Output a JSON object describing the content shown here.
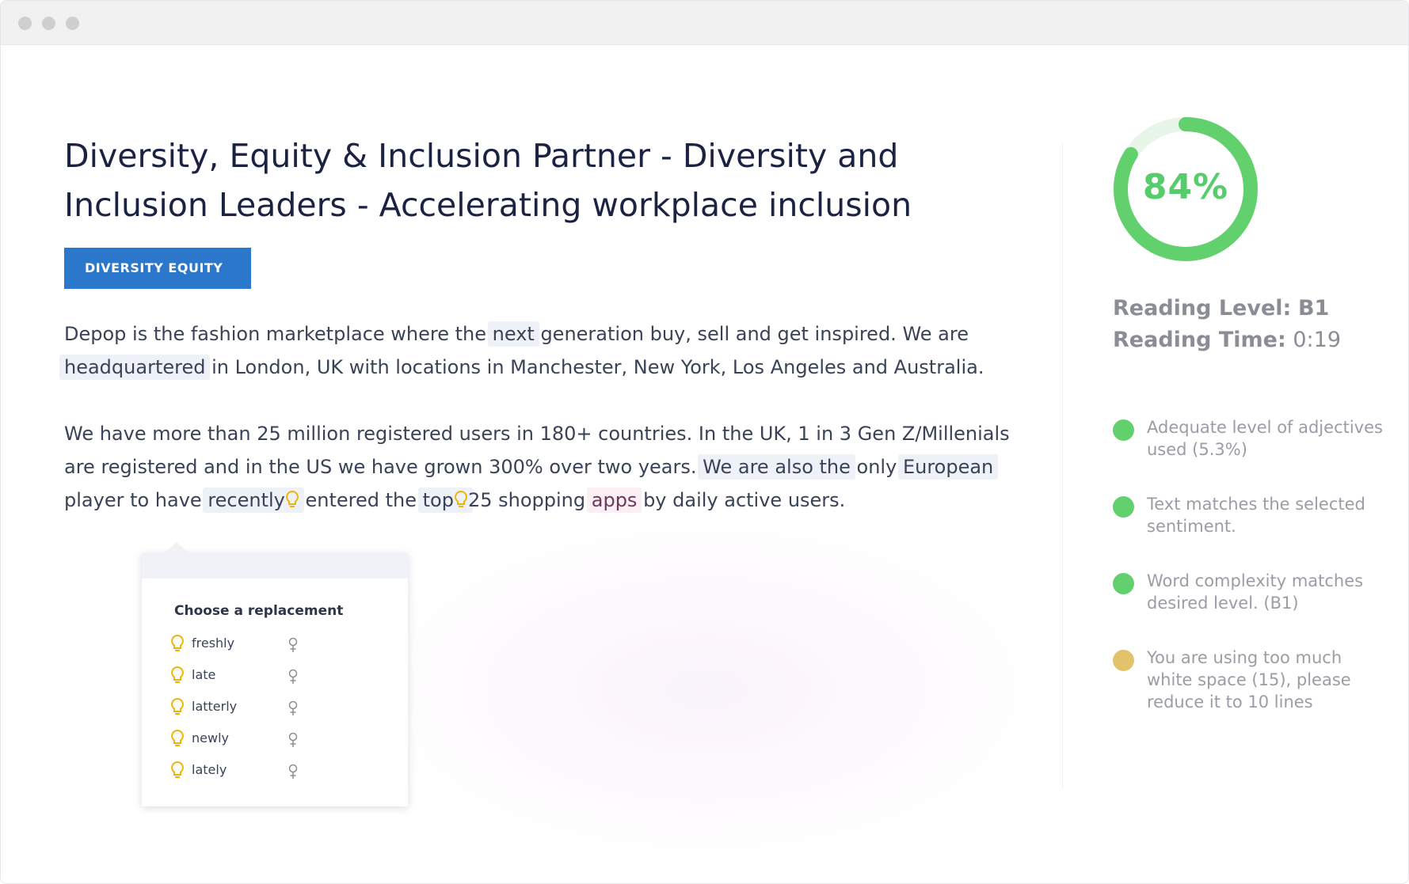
{
  "window": {
    "title_bar_buttons": [
      "close",
      "minimize",
      "maximize"
    ]
  },
  "document": {
    "title": "Diversity, Equity & Inclusion Partner - Diversity and Inclusion Leaders - Accelerating workplace inclusion",
    "tag": "DIVERSITY EQUITY",
    "paragraph1": {
      "t1": "Depop is the fashion marketplace where the ",
      "h1": "next",
      "t2": " generation buy, sell and get inspired. We are ",
      "h2": "headquartered",
      "t3": " in London, UK with locations in Manchester, New York, Los Angeles and Australia."
    },
    "paragraph2": {
      "t1": "We have more than 25 million registered users in 180+ countries. In the UK, 1 in 3 Gen Z/Millenials are registered and in the US we have grown 300% over two years. ",
      "h1": "We are also the",
      "t2": " only ",
      "h2": "European",
      "t3": " player to have ",
      "h3": "recently",
      "t4": " entered the ",
      "h4": "top",
      "t5": "25 shopping ",
      "h5": "apps",
      "t6": " by daily active users."
    }
  },
  "replacement_popup": {
    "title": "Choose a replacement",
    "options": [
      "freshly",
      "late",
      "latterly",
      "newly",
      "lately"
    ]
  },
  "sidebar": {
    "score": "84%",
    "score_value": 0.84,
    "reading_level_label": "Reading Level:",
    "reading_level_value": "B1",
    "reading_time_label": "Reading Time:",
    "reading_time_value": "0:19",
    "checks": [
      {
        "text": "Adequate level of adjectives used (5.3%)",
        "status": "ok",
        "color": "#63d06e"
      },
      {
        "text": "Text matches the selected sentiment.",
        "status": "ok",
        "color": "#63d06e"
      },
      {
        "text": "Word complexity matches desired level. (B1)",
        "status": "ok",
        "color": "#63d06e"
      },
      {
        "text": "You are using too much white space (15), please reduce it to 10 lines",
        "status": "warning",
        "color": "#e3c36a"
      }
    ]
  },
  "colors": {
    "accent": "#2b77cc",
    "score_green": "#56cc6c",
    "bulb_yellow": "#f0b400"
  }
}
